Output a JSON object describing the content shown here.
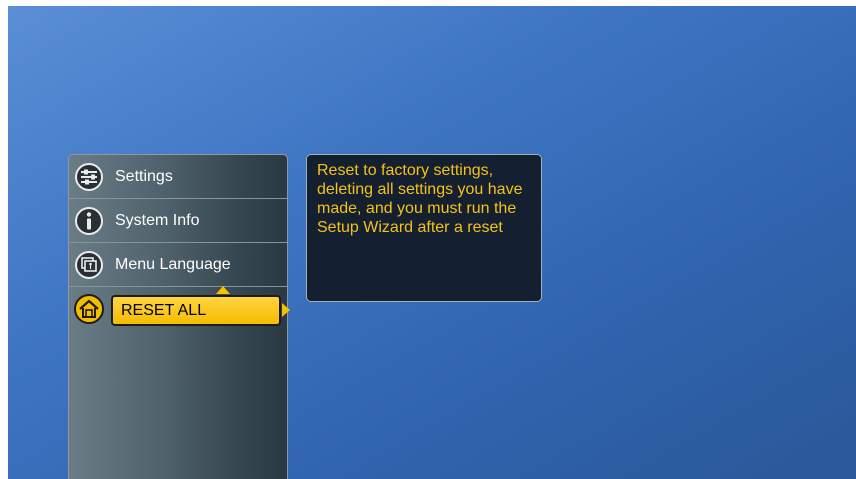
{
  "menu": {
    "items": [
      {
        "label": "Settings",
        "icon": "settings-sliders-icon"
      },
      {
        "label": "System Info",
        "icon": "info-icon"
      },
      {
        "label": "Menu Language",
        "icon": "language-icon"
      },
      {
        "label": "RESET ALL",
        "icon": "home-reset-icon",
        "selected": true
      }
    ]
  },
  "info": {
    "text": "Reset to factory settings, deleting all settings you have made, and you must run the Setup Wizard after a reset"
  },
  "colors": {
    "accent": "#f5bd00",
    "info_text": "#f4c11a",
    "info_bg": "#142030",
    "background": "#3f76c4"
  }
}
